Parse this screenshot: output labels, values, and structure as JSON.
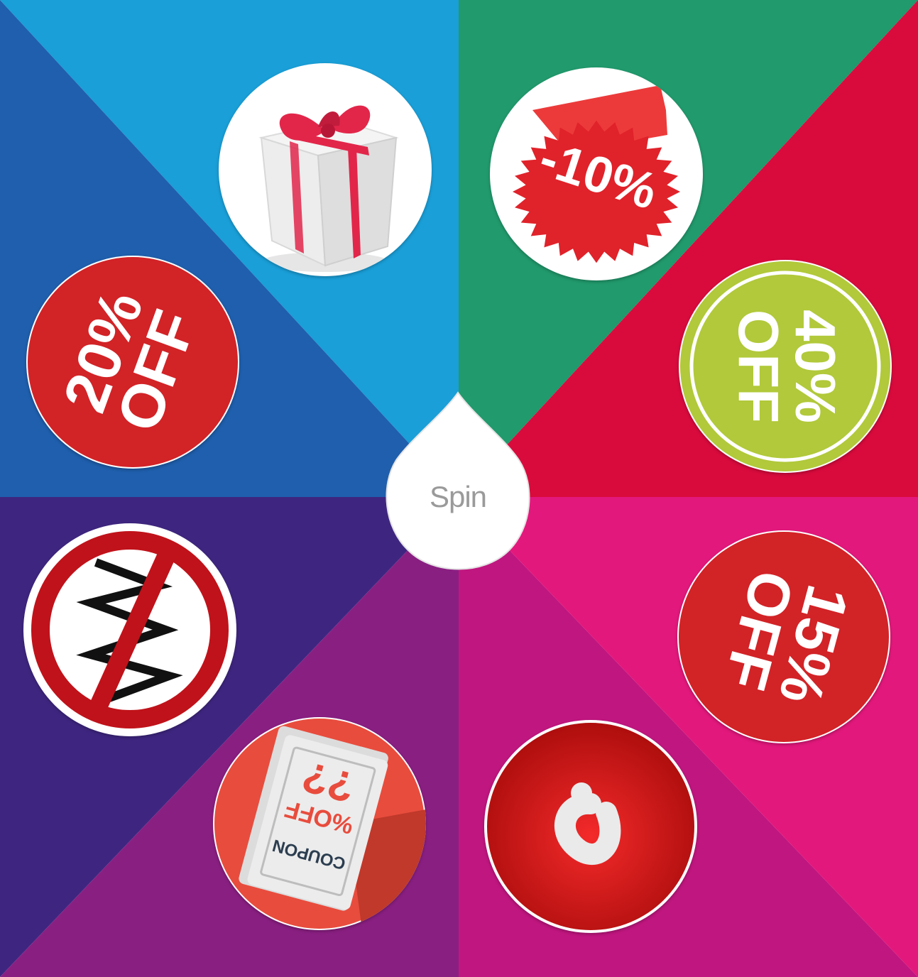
{
  "wheel": {
    "spin_label": "Spin",
    "colors": {
      "sky_blue": "#1a9fd8",
      "royal_blue": "#1f5fad",
      "green": "#219a6d",
      "crimson": "#d90b3d",
      "indigo": "#3e2680",
      "purple": "#8a1f82",
      "magenta": "#c0167f",
      "pink": "#e3187c"
    },
    "prizes": [
      {
        "name": "gift-box",
        "icon": "gift-box-icon"
      },
      {
        "name": "ten-percent-off",
        "text": "-10%",
        "icon": "starburst-sticker-icon"
      },
      {
        "name": "forty-percent-off",
        "line1": "40%",
        "line2": "OFF",
        "icon": "green-sticker-icon"
      },
      {
        "name": "fifteen-percent-off",
        "line1": "15%",
        "line2": "OFF",
        "icon": "red-sticker-icon"
      },
      {
        "name": "mystery",
        "icon": "question-mark-icon"
      },
      {
        "name": "coupon",
        "coupon_title": "COUPON",
        "coupon_amount": "??",
        "coupon_off": "%OFF",
        "icon": "coupon-icon"
      },
      {
        "name": "no-win",
        "icon": "prohibited-icon"
      },
      {
        "name": "twenty-percent-off",
        "line1": "20%",
        "line2": "OFF",
        "icon": "red-sticker-icon"
      }
    ]
  }
}
